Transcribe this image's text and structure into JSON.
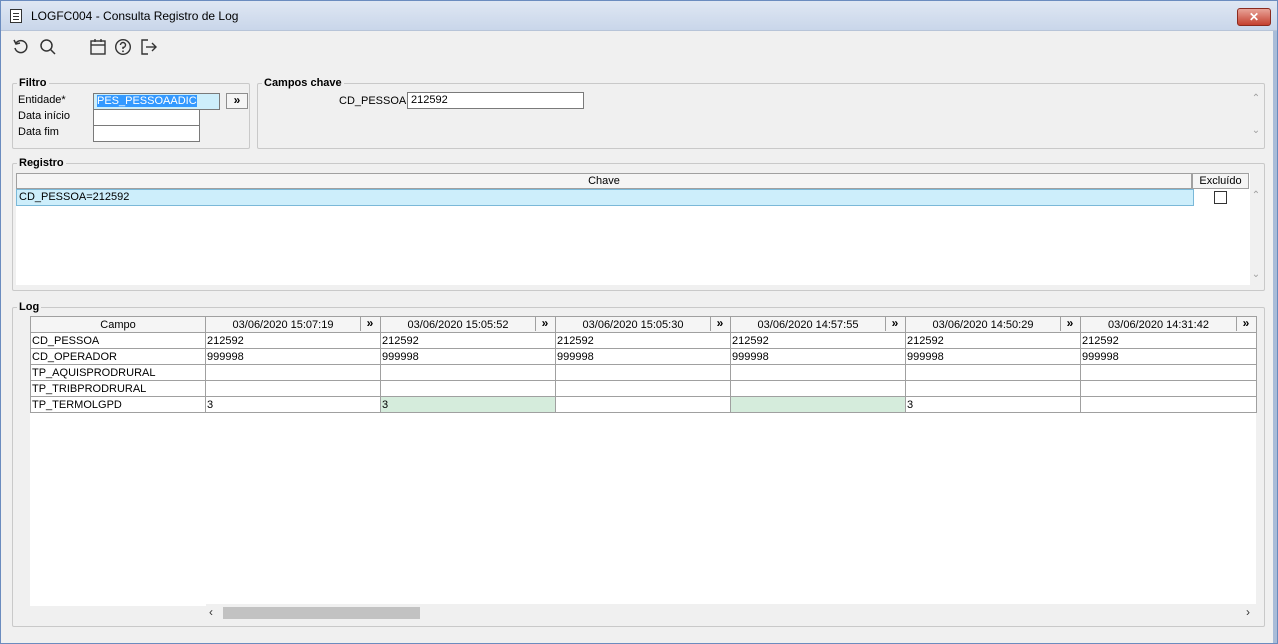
{
  "window": {
    "title": "LOGFC004 - Consulta Registro de Log",
    "close_label": "✕"
  },
  "toolbar": {
    "icons": [
      "undo-icon",
      "search-icon",
      "calendar-icon",
      "help-icon",
      "exit-icon"
    ]
  },
  "filtro": {
    "legend": "Filtro",
    "entidade_label": "Entidade*",
    "entidade_value": "PES_PESSOAADIC",
    "more_label": "»",
    "data_inicio_label": "Data início",
    "data_inicio_value": "",
    "data_fim_label": "Data fim",
    "data_fim_value": ""
  },
  "campos_chave": {
    "legend": "Campos chave",
    "cd_pessoa_label": "CD_PESSOA",
    "cd_pessoa_value": "212592"
  },
  "registro": {
    "legend": "Registro",
    "col_chave": "Chave",
    "col_excluido": "Excluído",
    "rows": [
      {
        "chave": "CD_PESSOA=212592",
        "excluido": false
      }
    ]
  },
  "log": {
    "legend": "Log",
    "col_campo": "Campo",
    "more_label": "»",
    "columns": [
      "03/06/2020 15:07:19",
      "03/06/2020 15:05:52",
      "03/06/2020 15:05:30",
      "03/06/2020 14:57:55",
      "03/06/2020 14:50:29",
      "03/06/2020 14:31:42"
    ],
    "rows": [
      {
        "campo": "CD_PESSOA",
        "values": [
          "212592",
          "212592",
          "212592",
          "212592",
          "212592",
          "212592"
        ]
      },
      {
        "campo": "CD_OPERADOR",
        "values": [
          "999998",
          "999998",
          "999998",
          "999998",
          "999998",
          "999998"
        ]
      },
      {
        "campo": "TP_AQUISPRODRURAL",
        "values": [
          "",
          "",
          "",
          "",
          "",
          ""
        ]
      },
      {
        "campo": "TP_TRIBPRODRURAL",
        "values": [
          "",
          "",
          "",
          "",
          "",
          ""
        ]
      },
      {
        "campo": "TP_TERMOLGPD",
        "values": [
          "3",
          "3",
          "",
          "",
          "3",
          ""
        ],
        "changed": [
          false,
          true,
          false,
          true,
          false,
          false
        ]
      }
    ],
    "scroll_left": "‹",
    "scroll_right": "›"
  },
  "colors": {
    "selected_row": "#cdeefb",
    "changed_cell": "#d5ecdc",
    "close_button": "#c4402f"
  }
}
